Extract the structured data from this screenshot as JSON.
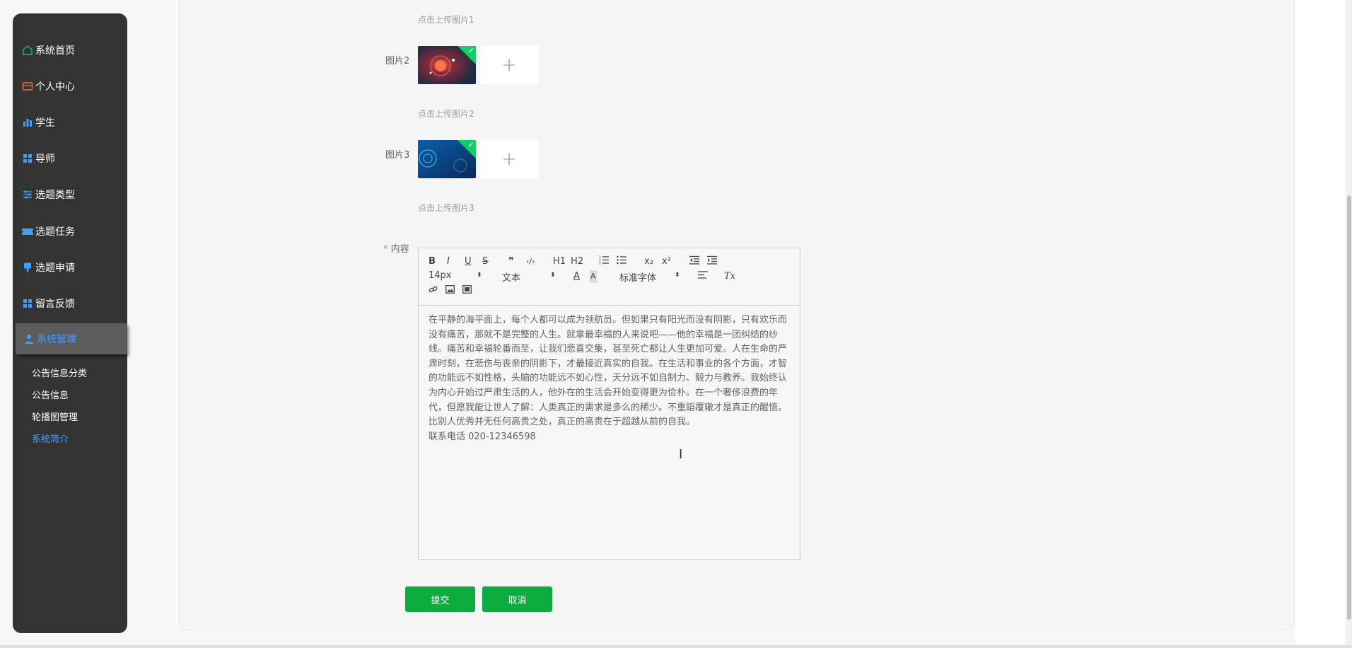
{
  "sidebar": {
    "items": [
      {
        "label": "系统首页",
        "icon": "home-icon"
      },
      {
        "label": "个人中心",
        "icon": "card-icon"
      },
      {
        "label": "学生",
        "icon": "bar-chart-icon"
      },
      {
        "label": "导师",
        "icon": "grid-icon"
      },
      {
        "label": "选题类型",
        "icon": "sliders-icon"
      },
      {
        "label": "选题任务",
        "icon": "ticket-icon"
      },
      {
        "label": "选题申请",
        "icon": "bookmark-icon"
      },
      {
        "label": "留言反馈",
        "icon": "grid-icon"
      }
    ],
    "active": {
      "label": "系统管理",
      "icon": "user-icon"
    },
    "subitems": [
      {
        "label": "公告信息分类"
      },
      {
        "label": "公告信息"
      },
      {
        "label": "轮播图管理"
      },
      {
        "label": "系统简介"
      }
    ],
    "active_sub": "系统简介"
  },
  "form": {
    "hint1": "点击上传图片1",
    "img2_label": "图片2",
    "hint2": "点击上传图片2",
    "img3_label": "图片3",
    "hint3": "点击上传图片3",
    "content_label": "内容",
    "required_mark": "*",
    "upload_plus": "+"
  },
  "editor": {
    "toolbar": {
      "bold": "B",
      "italic": "I",
      "underline": "U",
      "strike": "S",
      "quote": "❞",
      "code": "‹/›",
      "h1": "H1",
      "h2": "H2",
      "ordered": "☰",
      "bullet": "☰",
      "sub": "x₂",
      "sup": "x²",
      "outdent": "⇤",
      "indent": "⇥",
      "size": "14px",
      "header": "文本",
      "font": "标准字体",
      "align": "≡",
      "clean": "Tx"
    },
    "content": "在平静的海平面上，每个人都可以成为领航员。但如果只有阳光而没有阴影，只有欢乐而没有痛苦，那就不是完整的人生。就拿最幸福的人来说吧——他的幸福是一团纠结的纱线。痛苦和幸福轮番而至，让我们悲喜交集，甚至死亡都让人生更加可爱。人在生命的严肃时刻，在悲伤与丧亲的阴影下，才最接近真实的自我。在生活和事业的各个方面，才智的功能远不如性格，头脑的功能远不如心性，天分远不如自制力、毅力与教养。我始终认为内心开始过严肃生活的人，他外在的生活会开始变得更为俭朴。在一个奢侈浪费的年代，但愿我能让世人了解：人类真正的需求是多么的稀少。不重蹈覆辙才是真正的醒悟。比别人优秀并无任何高贵之处，真正的高贵在于超越从前的自我。",
    "contact": "联系电话 020-12346598"
  },
  "buttons": {
    "submit": "提交",
    "cancel": "取消"
  },
  "colors": {
    "accent": "#409eff",
    "green": "#0cab3e",
    "sidebar": "#333333"
  }
}
